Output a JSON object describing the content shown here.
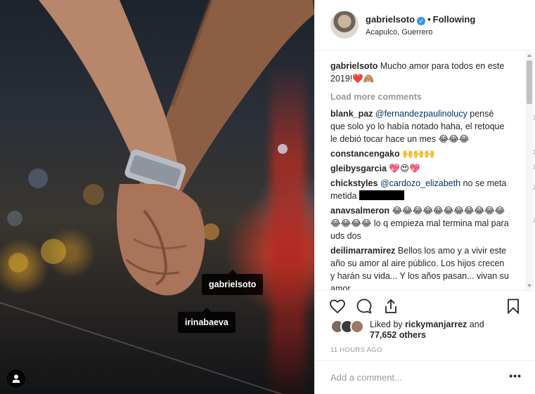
{
  "post": {
    "tags": [
      "gabrielsoto",
      "irinabaeva"
    ]
  },
  "header": {
    "username": "gabrielsoto",
    "verified_icon": "verified-badge-icon",
    "separator": "•",
    "follow_status": "Following",
    "location": "Acapulco, Guerrero"
  },
  "caption": {
    "user": "gabrielsoto",
    "text": "Mucho amor para todos en este 2019!❤️🙈"
  },
  "load_more": "Load more comments",
  "comments": [
    {
      "user": "blank_paz",
      "mention": "@fernandezpaulinolucy",
      "text": "pensé que solo yo lo había notado haha, el retoque le debió tocar hace un mes 😂😂😂"
    },
    {
      "user": "constancengako",
      "mention": "",
      "text": "🙌🙌🙌"
    },
    {
      "user": "gleibysgarcia",
      "mention": "",
      "text": "💖😍💖"
    },
    {
      "user": "chickstyles",
      "mention": "@cardozo_elizabeth",
      "text": "no se meta metida"
    },
    {
      "user": "anavsalmeron",
      "mention": "",
      "text": "😂😂😂😂😂😂😂😂😂😂😂😂😂😂😂 lo q empieza mal termina mal para uds dos"
    },
    {
      "user": "deilimarramirez",
      "mention": "",
      "text": "Bellos los amo y a vivir este año su amor al aire público. Los hijos crecen y harán su vida... Y los años pasan... vivan su amor"
    }
  ],
  "likes": {
    "prefix": "Liked by",
    "user": "rickymanjarrez",
    "and": "and",
    "count": "77,652 others"
  },
  "timestamp": "11 HOURS AGO",
  "add_comment": {
    "placeholder": "Add a comment...",
    "more": "•••"
  },
  "colors": {
    "accent_blue": "#3897f0",
    "mention": "#003569",
    "muted": "#999999",
    "border": "#efefef"
  }
}
